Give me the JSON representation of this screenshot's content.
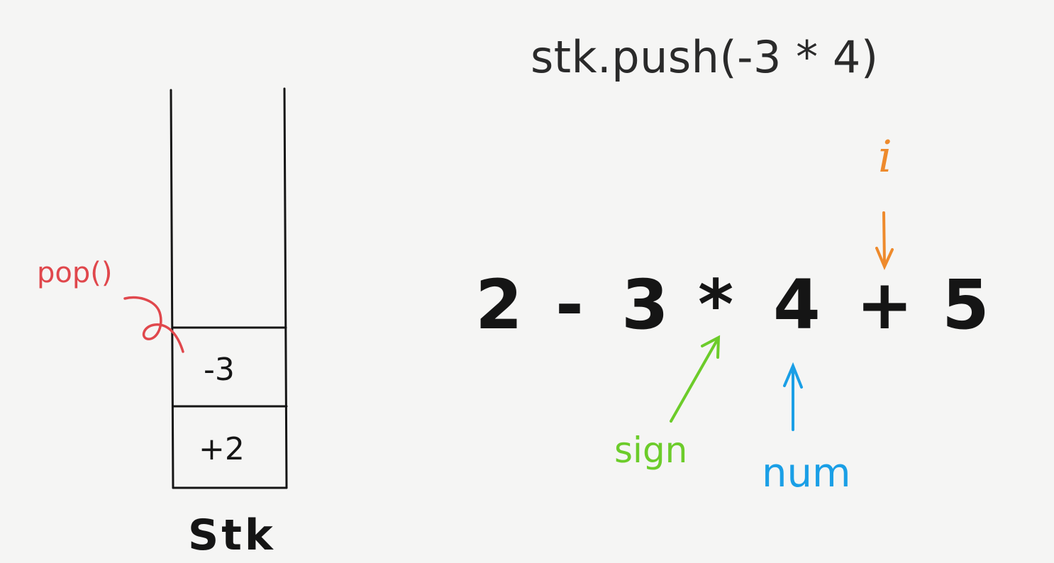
{
  "code": {
    "text": "stk.push(-3 * 4)"
  },
  "expression": {
    "tokens": [
      "2",
      "-",
      "3",
      "*",
      "4",
      "+",
      "5"
    ]
  },
  "stack": {
    "label": "Stk",
    "cells": [
      "-3",
      "+2"
    ],
    "pop_label": "pop()"
  },
  "pointers": {
    "i": "i",
    "sign": "sign",
    "num": "num"
  },
  "colors": {
    "background": "#f5f5f4",
    "ink": "#151515",
    "pop": "#e0474c",
    "i": "#ee8a2c",
    "sign": "#6ccc2a",
    "num": "#1a9fe6"
  }
}
